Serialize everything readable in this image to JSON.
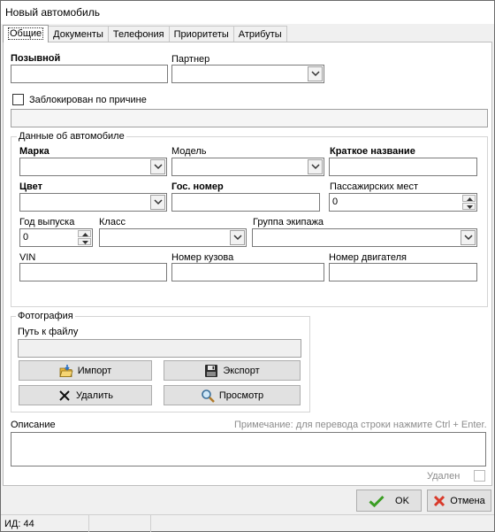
{
  "window": {
    "title": "Новый автомобиль"
  },
  "tabs": [
    {
      "label": "Общие",
      "active": true
    },
    {
      "label": "Документы"
    },
    {
      "label": "Телефония"
    },
    {
      "label": "Приоритеты"
    },
    {
      "label": "Атрибуты"
    }
  ],
  "general": {
    "callsign_label": "Позывной",
    "callsign_value": "",
    "partner_label": "Партнер",
    "partner_value": "",
    "blocked_label": "Заблокирован по причине",
    "blocked_reason": ""
  },
  "car": {
    "group_title": "Данные об автомобиле",
    "brand_label": "Марка",
    "model_label": "Модель",
    "short_name_label": "Краткое название",
    "color_label": "Цвет",
    "plate_label": "Гос. номер",
    "seats_label": "Пассажирских мест",
    "seats_value": "0",
    "year_label": "Год выпуска",
    "year_value": "0",
    "class_label": "Класс",
    "crew_group_label": "Группа экипажа",
    "vin_label": "VIN",
    "body_number_label": "Номер кузова",
    "engine_number_label": "Номер двигателя"
  },
  "photo": {
    "group_title": "Фотография",
    "path_label": "Путь к файлу",
    "path_value": "",
    "import_label": "Импорт",
    "export_label": "Экспорт",
    "delete_label": "Удалить",
    "view_label": "Просмотр"
  },
  "description": {
    "label": "Описание",
    "hint": "Примечание: для перевода строки нажмите Ctrl + Enter.",
    "value": ""
  },
  "deleted_label": "Удален",
  "buttons": {
    "ok": "OK",
    "cancel": "Отмена"
  },
  "status": {
    "id_text": "ИД: 44"
  },
  "colors": {
    "ok_green": "#3a9d23",
    "cancel_red": "#d93a2b",
    "hint_gray": "#8c8c8c"
  },
  "icons": [
    "chevron-down-icon",
    "import-icon",
    "floppy-disk-icon",
    "close-icon",
    "magnifier-icon",
    "checkmark-icon",
    "cross-icon"
  ]
}
